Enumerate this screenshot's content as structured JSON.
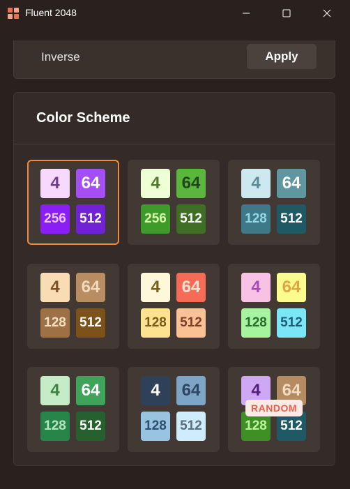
{
  "window": {
    "title": "Fluent 2048",
    "icon_colors": [
      "#e8704f",
      "#f3a585",
      "#f3a585",
      "#e8704f"
    ]
  },
  "inverse": {
    "label": "Inverse",
    "apply_label": "Apply"
  },
  "scheme": {
    "title": "Color Scheme",
    "cards": [
      {
        "tiles": [
          {
            "v": "4",
            "bg": "#f6d9fd",
            "fg": "#6d3d86"
          },
          {
            "v": "64",
            "bg": "#a64ef6",
            "fg": "#ffffff"
          },
          {
            "v": "256",
            "bg": "#8a1ff4",
            "fg": "#e9c8ff"
          },
          {
            "v": "512",
            "bg": "#7222d6",
            "fg": "#ffffff"
          }
        ]
      },
      {
        "tiles": [
          {
            "v": "4",
            "bg": "#eeffd6",
            "fg": "#51792f"
          },
          {
            "v": "64",
            "bg": "#5bb63d",
            "fg": "#22461a"
          },
          {
            "v": "256",
            "bg": "#3e9a2b",
            "fg": "#d8ffaa"
          },
          {
            "v": "512",
            "bg": "#3e6f24",
            "fg": "#ffffff"
          }
        ]
      },
      {
        "tiles": [
          {
            "v": "4",
            "bg": "#cde9ef",
            "fg": "#5b8a97"
          },
          {
            "v": "64",
            "bg": "#5f97a1",
            "fg": "#ffffff"
          },
          {
            "v": "128",
            "bg": "#3f7888",
            "fg": "#8fd8e6"
          },
          {
            "v": "512",
            "bg": "#1f5966",
            "fg": "#ffffff"
          }
        ]
      },
      {
        "tiles": [
          {
            "v": "4",
            "bg": "#f9dcb4",
            "fg": "#7b5126"
          },
          {
            "v": "64",
            "bg": "#b88d61",
            "fg": "#f1d9bd"
          },
          {
            "v": "128",
            "bg": "#9e7046",
            "fg": "#f4e0c5"
          },
          {
            "v": "512",
            "bg": "#7d5218",
            "fg": "#ffffff"
          }
        ]
      },
      {
        "tiles": [
          {
            "v": "4",
            "bg": "#fff7d9",
            "fg": "#7b5d20"
          },
          {
            "v": "64",
            "bg": "#f56b55",
            "fg": "#fbe0d0"
          },
          {
            "v": "128",
            "bg": "#fde292",
            "fg": "#775a1a"
          },
          {
            "v": "512",
            "bg": "#f9c194",
            "fg": "#7c3d26"
          }
        ]
      },
      {
        "tiles": [
          {
            "v": "4",
            "bg": "#f8c2e5",
            "fg": "#a74bb6"
          },
          {
            "v": "64",
            "bg": "#fbfb8e",
            "fg": "#e1a444"
          },
          {
            "v": "128",
            "bg": "#a6f4a0",
            "fg": "#2a6a2c"
          },
          {
            "v": "512",
            "bg": "#7ae6f8",
            "fg": "#1f5b78"
          }
        ]
      },
      {
        "tiles": [
          {
            "v": "4",
            "bg": "#c5ecc7",
            "fg": "#3c8047"
          },
          {
            "v": "64",
            "bg": "#3fa45a",
            "fg": "#ffffff"
          },
          {
            "v": "128",
            "bg": "#27854a",
            "fg": "#b3e6bf"
          },
          {
            "v": "512",
            "bg": "#27602f",
            "fg": "#ffffff"
          }
        ]
      },
      {
        "tiles": [
          {
            "v": "4",
            "bg": "#2f4159",
            "fg": "#ffffff"
          },
          {
            "v": "64",
            "bg": "#7da6c6",
            "fg": "#2e4663"
          },
          {
            "v": "128",
            "bg": "#98c4e2",
            "fg": "#2e4f6c"
          },
          {
            "v": "512",
            "bg": "#cfecfd",
            "fg": "#5a6e7e"
          }
        ]
      },
      {
        "tiles": [
          {
            "v": "4",
            "bg": "#cea7f5",
            "fg": "#4f1f7a"
          },
          {
            "v": "64",
            "bg": "#b58c61",
            "fg": "#f2dcc1"
          },
          {
            "v": "128",
            "bg": "#3f8f27",
            "fg": "#bdf59c"
          },
          {
            "v": "512",
            "bg": "#1f5966",
            "fg": "#ffffff"
          }
        ],
        "badge": "RANDOM"
      }
    ]
  }
}
